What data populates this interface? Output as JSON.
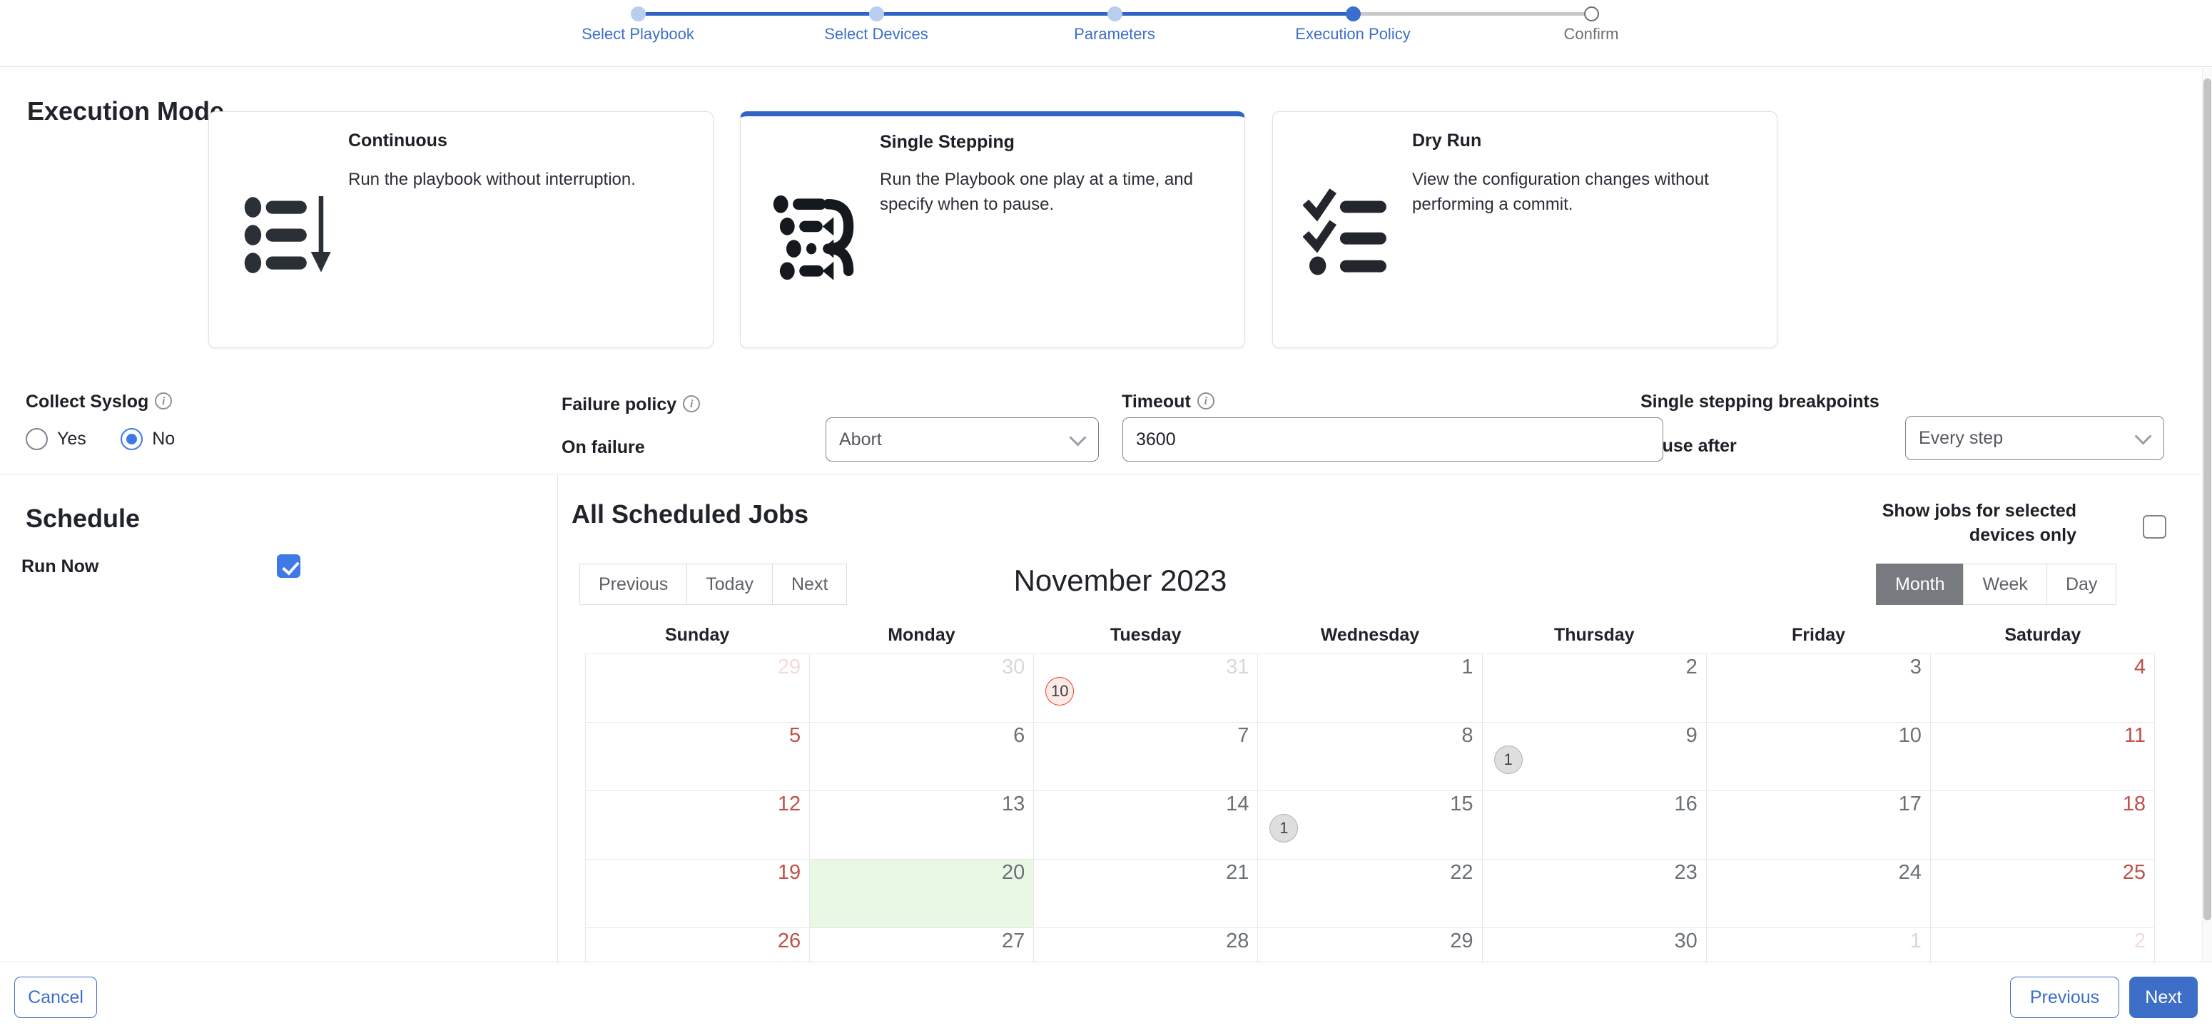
{
  "stepper": {
    "steps": [
      {
        "label": "Select Playbook",
        "state": "done"
      },
      {
        "label": "Select Devices",
        "state": "done"
      },
      {
        "label": "Parameters",
        "state": "done"
      },
      {
        "label": "Execution Policy",
        "state": "current"
      },
      {
        "label": "Confirm",
        "state": "todo"
      }
    ]
  },
  "execution_mode": {
    "heading": "Execution Mode",
    "cards": [
      {
        "name": "Continuous",
        "description": "Run the playbook without interruption.",
        "icon": "ordered-list-down-arrow-icon",
        "selected": false
      },
      {
        "name": "Single Stepping",
        "description": "Run the Playbook one play at a time, and specify when to pause.",
        "icon": "list-step-loop-icon",
        "selected": true
      },
      {
        "name": "Dry Run",
        "description": "View the configuration changes without performing a commit.",
        "icon": "checklist-icon",
        "selected": false
      }
    ]
  },
  "options": {
    "collect_syslog": {
      "label": "Collect Syslog",
      "info_icon": "info-icon",
      "options": [
        "Yes",
        "No"
      ],
      "selected": "No"
    },
    "failure_policy": {
      "label": "Failure policy",
      "info_icon": "info-icon",
      "sub_label": "On failure",
      "value": "Abort",
      "chevron": "chevron-down-icon"
    },
    "timeout": {
      "label": "Timeout",
      "info_icon": "info-icon",
      "value": "3600"
    },
    "breakpoints": {
      "label": "Single stepping breakpoints",
      "sub_label": "Pause after",
      "value": "Every step",
      "chevron": "chevron-down-icon"
    }
  },
  "schedule": {
    "heading": "Schedule",
    "run_now_label": "Run Now",
    "run_now_checked": true
  },
  "jobs": {
    "heading": "All Scheduled Jobs",
    "nav": [
      "Previous",
      "Today",
      "Next"
    ],
    "month_title": "November 2023",
    "show_jobs_label": "Show jobs for selected devices only",
    "show_jobs_checked": false,
    "views": [
      "Month",
      "Week",
      "Day"
    ],
    "active_view": "Month"
  },
  "calendar": {
    "day_headers": [
      "Sunday",
      "Monday",
      "Tuesday",
      "Wednesday",
      "Thursday",
      "Friday",
      "Saturday"
    ],
    "weeks": [
      [
        {
          "day": "29",
          "outside": true
        },
        {
          "day": "30",
          "outside": true
        },
        {
          "day": "31",
          "outside": true,
          "badge": "10",
          "badge_type": "red"
        },
        {
          "day": "1"
        },
        {
          "day": "2"
        },
        {
          "day": "3"
        },
        {
          "day": "4"
        }
      ],
      [
        {
          "day": "5"
        },
        {
          "day": "6"
        },
        {
          "day": "7"
        },
        {
          "day": "8"
        },
        {
          "day": "9",
          "badge": "1",
          "badge_type": "gray"
        },
        {
          "day": "10"
        },
        {
          "day": "11"
        }
      ],
      [
        {
          "day": "12"
        },
        {
          "day": "13"
        },
        {
          "day": "14"
        },
        {
          "day": "15",
          "badge": "1",
          "badge_type": "gray"
        },
        {
          "day": "16"
        },
        {
          "day": "17"
        },
        {
          "day": "18"
        }
      ],
      [
        {
          "day": "19"
        },
        {
          "day": "20",
          "today": true
        },
        {
          "day": "21"
        },
        {
          "day": "22"
        },
        {
          "day": "23"
        },
        {
          "day": "24"
        },
        {
          "day": "25"
        }
      ],
      [
        {
          "day": "26"
        },
        {
          "day": "27"
        },
        {
          "day": "28"
        },
        {
          "day": "29"
        },
        {
          "day": "30"
        },
        {
          "day": "1",
          "outside": true
        },
        {
          "day": "2",
          "outside": true
        }
      ]
    ]
  },
  "footer": {
    "cancel": "Cancel",
    "previous": "Previous",
    "next": "Next"
  },
  "colors": {
    "accent_blue": "#3d6fc8",
    "step_done": "#b9cdee",
    "today_green": "#e9f7e5",
    "badge_red": "#e0452c",
    "weekend_red": "#c0504a"
  }
}
